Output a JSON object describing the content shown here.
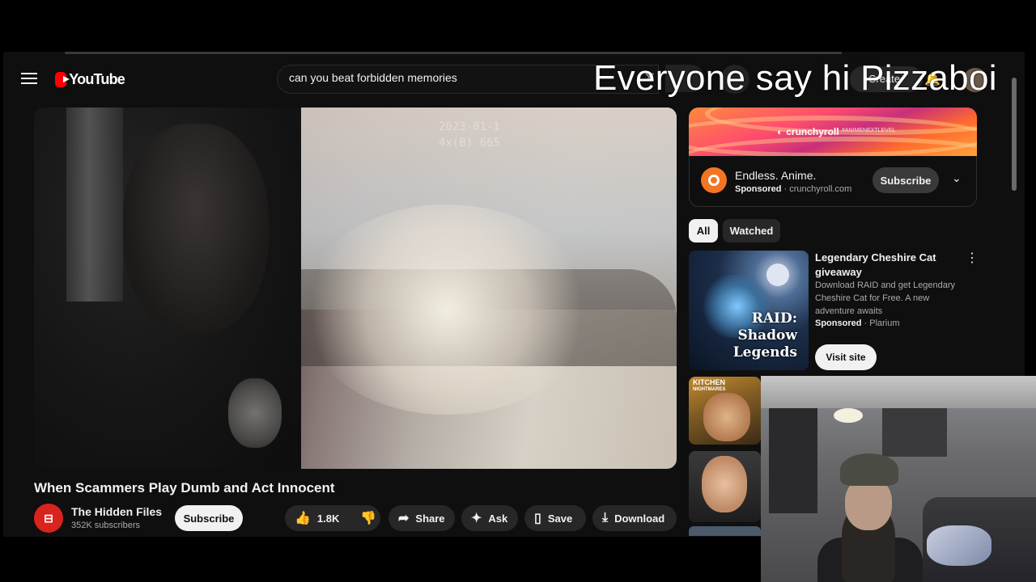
{
  "header": {
    "logo_text": "YouTube",
    "search_value": "can you beat forbidden memories",
    "create_label": "Create"
  },
  "overlay_text": "Everyone say hi Pizzaboi",
  "video": {
    "stamp_line1": "2023-01-1",
    "stamp_line2": "4x(B) 665",
    "title": "When Scammers Play Dumb and Act Innocent",
    "channel_name": "The Hidden Files",
    "channel_subs": "352K subscribers",
    "subscribe_label": "Subscribe",
    "like_count": "1.8K",
    "share_label": "Share",
    "ask_label": "Ask",
    "save_label": "Save",
    "download_label": "Download"
  },
  "ad": {
    "brand": "crunchyroll",
    "tag": "#ANIMENEXTLEVEL",
    "title": "Endless. Anime.",
    "sponsored": "Sponsored",
    "domain": "crunchyroll.com",
    "subscribe_label": "Subscribe"
  },
  "chips": [
    "All",
    "Watched"
  ],
  "promo": {
    "thumb_text": [
      "RAID:",
      "Shadow",
      "Legends"
    ],
    "title": "Legendary Cheshire Cat giveaway",
    "description": "Download RAID and get Legendary Cheshire Cat for Free. A new adventure awaits",
    "sponsored": "Sponsored",
    "advertiser": "Plarium",
    "cta": "Visit site"
  },
  "thumb2_text": [
    "KITCHEN",
    "NIGHTMARES"
  ],
  "colors": {
    "brand_red": "#ff0000",
    "crunchyroll_orange": "#f47521",
    "bg": "#0f0f0f"
  }
}
